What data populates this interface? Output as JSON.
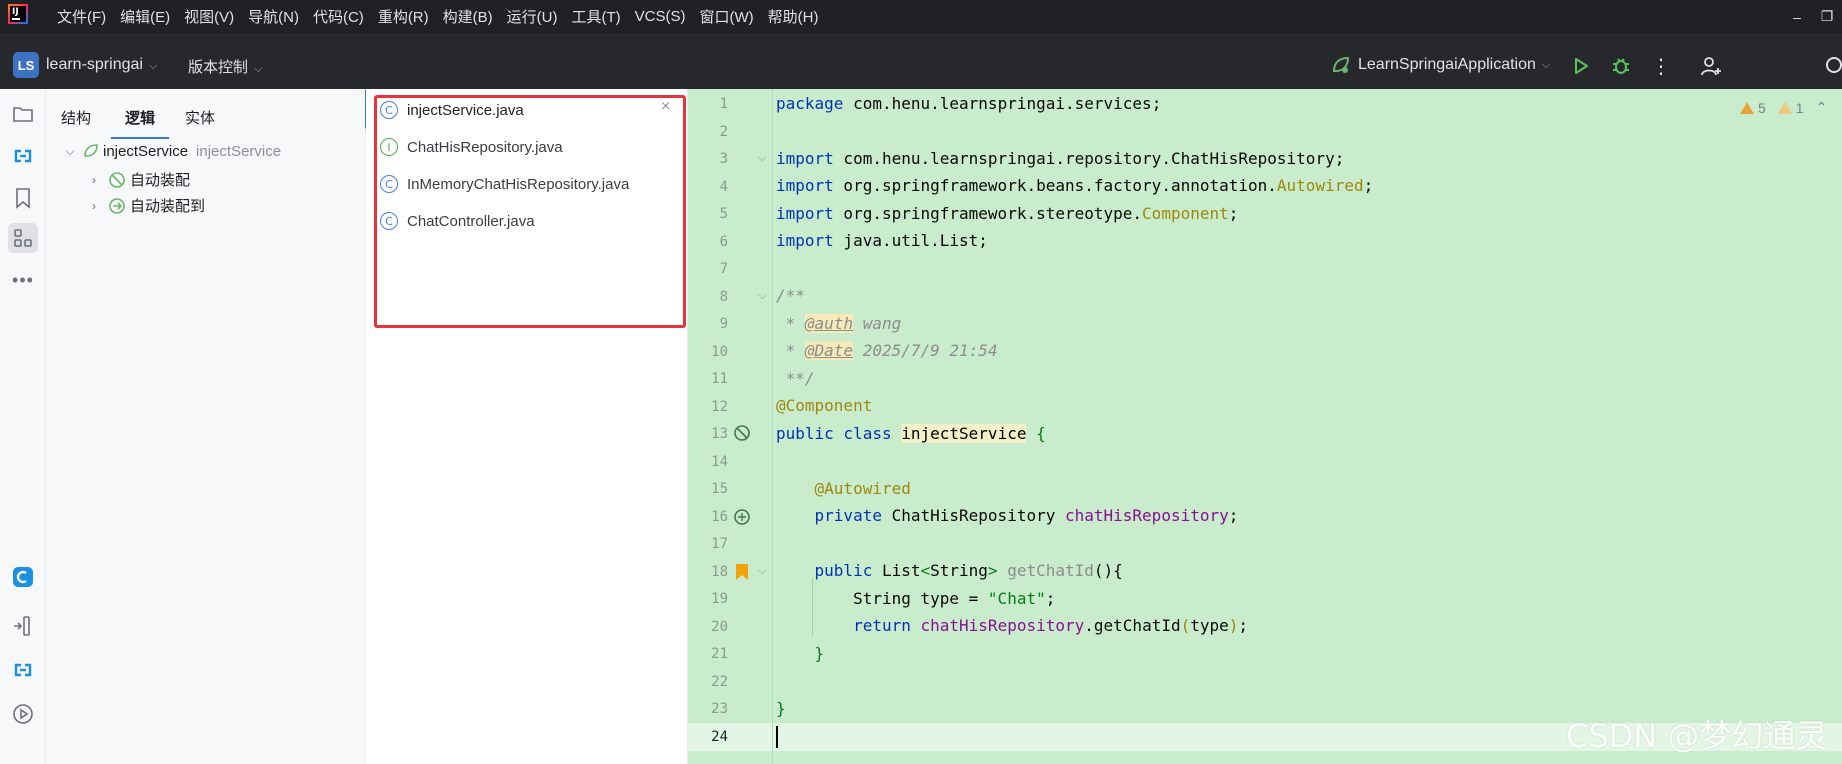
{
  "menubar": {
    "logo_text": "IJ",
    "items": [
      "文件(F)",
      "编辑(E)",
      "视图(V)",
      "导航(N)",
      "代码(C)",
      "重构(R)",
      "构建(B)",
      "运行(U)",
      "工具(T)",
      "VCS(S)",
      "窗口(W)",
      "帮助(H)"
    ],
    "minimize_glyph": "–",
    "restore_glyph": "❐"
  },
  "toolbar": {
    "project_badge": "LS",
    "project_name": "learn-springai",
    "vcs_label": "版本控制",
    "run_config": "LearnSpringaiApplication",
    "more_glyph": "⋮"
  },
  "structure": {
    "tabs": [
      "结构",
      "逻辑",
      "实体"
    ],
    "active_tab_index": 1,
    "root": {
      "name": "injectService",
      "hint": "injectService"
    },
    "children": [
      "自动装配",
      "自动装配到"
    ]
  },
  "files": {
    "items": [
      {
        "name": "injectService.java",
        "kind": "C"
      },
      {
        "name": "ChatHisRepository.java",
        "kind": "I"
      },
      {
        "name": "InMemoryChatHisRepository.java",
        "kind": "C"
      },
      {
        "name": "ChatController.java",
        "kind": "C"
      }
    ],
    "close_glyph": "×"
  },
  "editor": {
    "line_numbers": [
      "1",
      "2",
      "3",
      "4",
      "5",
      "6",
      "7",
      "8",
      "9",
      "10",
      "11",
      "12",
      "13",
      "14",
      "15",
      "16",
      "17",
      "18",
      "19",
      "20",
      "21",
      "22",
      "23",
      "24"
    ],
    "code": {
      "l1_kw": "package",
      "l1_rest": " com.henu.learnspringai.services;",
      "l3_kw": "import",
      "l3_rest": " com.henu.learnspringai.repository.ChatHisRepository;",
      "l4_kw": "import",
      "l4_rest": " org.springframework.beans.factory.annotation.",
      "l4_ann": "Autowired",
      "l4_end": ";",
      "l5_kw": "import",
      "l5_rest": " org.springframework.stereotype.",
      "l5_ann": "Component",
      "l5_end": ";",
      "l6_kw": "import",
      "l6_rest": " java.util.List;",
      "l8": "/**",
      "l9_pre": " * ",
      "l9_tag": "@auth",
      "l9_val": " wang",
      "l10_pre": " * ",
      "l10_tag": "@Date",
      "l10_val": " 2025/7/9 21:54",
      "l11": " **/",
      "l12": "@Component",
      "l13_kw": "public class ",
      "l13_cls": "injectService",
      "l13_end": " {",
      "l15": "    @Autowired",
      "l16_kw": "    private ",
      "l16_type": "ChatHisRepository ",
      "l16_fld": "chatHisRepository",
      "l16_end": ";",
      "l18_kw": "    public ",
      "l18_type": "List",
      "l18_gen_open": "<",
      "l18_gen": "String",
      "l18_gen_close": "> ",
      "l18_meth": "getChatId",
      "l18_end": "(){",
      "l19_type": "        String type = ",
      "l19_str": "\"Chat\"",
      "l19_end": ";",
      "l20_kw": "        return ",
      "l20_fld": "chatHisRepository",
      "l20_mid": ".getChatId",
      "l20_open": "(",
      "l20_arg": "type",
      "l20_close": ")",
      "l20_end": ";",
      "l21": "    }",
      "l23": "}"
    }
  },
  "inspections": {
    "warnings": "5",
    "weak_warnings": "1",
    "collapse_glyph": "⌃"
  },
  "watermark": "CSDN @梦幻通灵",
  "colors": {
    "editor_bg": "#c9eccd",
    "highlight_box": "#e8333a",
    "accent": "#3574f0"
  }
}
